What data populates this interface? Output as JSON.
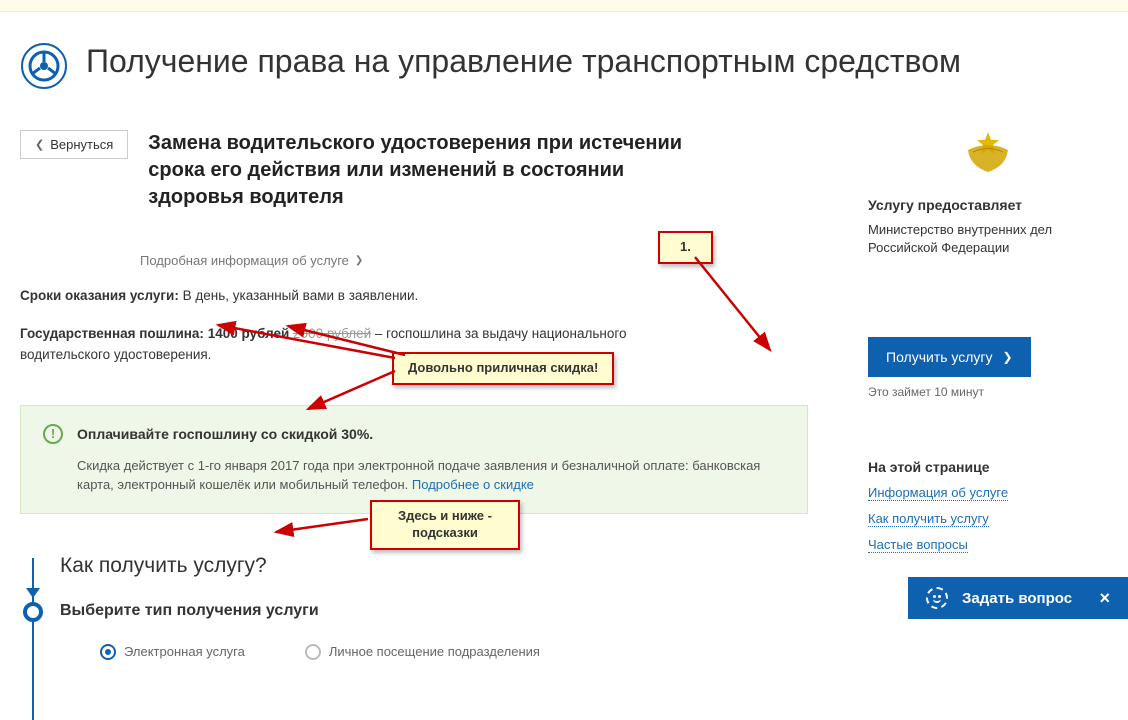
{
  "header": {
    "title": "Получение права на управление транспортным средством"
  },
  "back": {
    "label": "Вернуться"
  },
  "service": {
    "title": "Замена водительского удостоверения при истечении срока его действия или изменений в состоянии здоровья водителя",
    "details_link": "Подробная информация об услуге"
  },
  "timing": {
    "label": "Сроки оказания услуги:",
    "value": "В день, указанный вами в заявлении."
  },
  "fee": {
    "label": "Государственная пошлина:",
    "price": "1400 рублей",
    "old_price": "2000 рублей",
    "tail": "– госпошлина за выдачу национального водительского удостоверения."
  },
  "discount_box": {
    "title": "Оплачивайте госпошлину со скидкой 30%.",
    "text": "Скидка действует с 1-го января 2017 года при электронной подаче заявления и безналичной оплате: банковская карта, электронный кошелёк или мобильный телефон.",
    "link": "Подробнее о скидке"
  },
  "how": {
    "heading": "Как получить услугу?",
    "step1_title": "Выберите тип получения услуги",
    "options": [
      "Электронная услуга",
      "Личное посещение подразделения"
    ]
  },
  "sidebar": {
    "provides_label": "Услугу предоставляет",
    "provider": "Министерство внутренних дел Российской Федерации",
    "cta": "Получить услугу",
    "cta_note": "Это займет 10 минут",
    "on_page_label": "На этой странице",
    "links": [
      "Информация об услуге",
      "Как получить услугу",
      "Частые вопросы"
    ]
  },
  "annotations": {
    "num1": "1.",
    "discount_note": "Довольно приличная скидка!",
    "hints_note": "Здесь и ниже - подсказки"
  },
  "chat": {
    "label": "Задать вопрос"
  }
}
